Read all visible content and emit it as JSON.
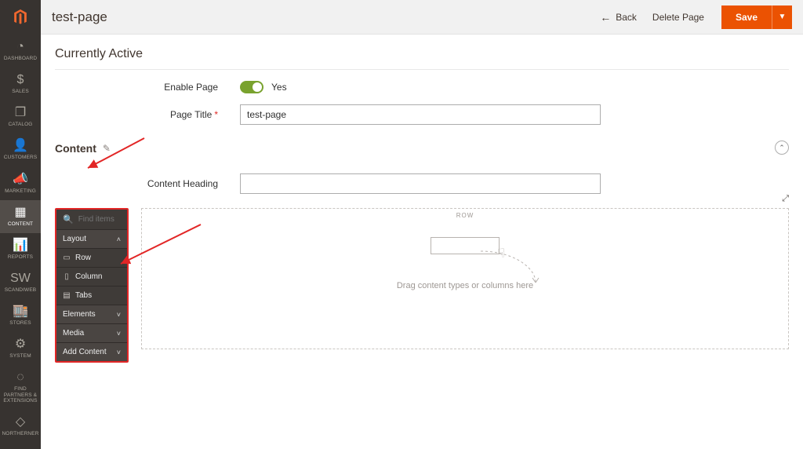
{
  "sidebar": {
    "items": [
      {
        "icon": "◔",
        "label": "DASHBOARD"
      },
      {
        "icon": "$",
        "label": "SALES"
      },
      {
        "icon": "❐",
        "label": "CATALOG"
      },
      {
        "icon": "👤",
        "label": "CUSTOMERS"
      },
      {
        "icon": "📣",
        "label": "MARKETING"
      },
      {
        "icon": "▦",
        "label": "CONTENT"
      },
      {
        "icon": "📊",
        "label": "REPORTS"
      },
      {
        "icon": "SW",
        "label": "SCANDIWEB"
      },
      {
        "icon": "🏬",
        "label": "STORES"
      },
      {
        "icon": "⚙",
        "label": "SYSTEM"
      },
      {
        "icon": "◌",
        "label": "FIND PARTNERS & EXTENSIONS"
      },
      {
        "icon": "◇",
        "label": "NORTHERNER"
      }
    ],
    "active_index": 5
  },
  "header": {
    "title": "test-page",
    "back_label": "Back",
    "delete_label": "Delete Page",
    "save_label": "Save"
  },
  "section": {
    "currently_active_title": "Currently Active",
    "enable_page_label": "Enable Page",
    "enable_page_value": "Yes",
    "page_title_label": "Page Title",
    "page_title_value": "test-page",
    "content_section_label": "Content",
    "content_heading_label": "Content Heading",
    "content_heading_value": ""
  },
  "palette": {
    "search_placeholder": "Find items",
    "groups": [
      {
        "label": "Layout",
        "expanded": true,
        "items": [
          {
            "icon": "▭",
            "label": "Row"
          },
          {
            "icon": "▯",
            "label": "Column"
          },
          {
            "icon": "▤",
            "label": "Tabs"
          }
        ]
      },
      {
        "label": "Elements",
        "expanded": false
      },
      {
        "label": "Media",
        "expanded": false
      },
      {
        "label": "Add Content",
        "expanded": false
      }
    ]
  },
  "canvas": {
    "row_label": "ROW",
    "drop_hint": "Drag content types or columns here"
  }
}
